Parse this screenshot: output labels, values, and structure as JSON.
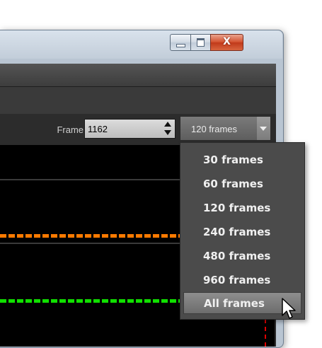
{
  "window": {
    "close_glyph": "X"
  },
  "toolbar": {
    "frame_label": "Frame",
    "frame_value": "1162",
    "range_selected": "120 frames"
  },
  "range_menu": {
    "items": [
      "30 frames",
      "60 frames",
      "120 frames",
      "240 frames",
      "480 frames",
      "960 frames",
      "All frames"
    ],
    "highlighted": "All frames"
  },
  "graph": {
    "series_colors": [
      "#ff7a00",
      "#10e000"
    ],
    "marker_color": "#e00000"
  },
  "icons": {
    "minimize": "minimize-icon",
    "maximize": "maximize-icon",
    "close": "close-icon",
    "spin": "spinner-arrows-icon",
    "dropdown": "chevron-down-icon",
    "cursor": "mouse-pointer-icon"
  }
}
